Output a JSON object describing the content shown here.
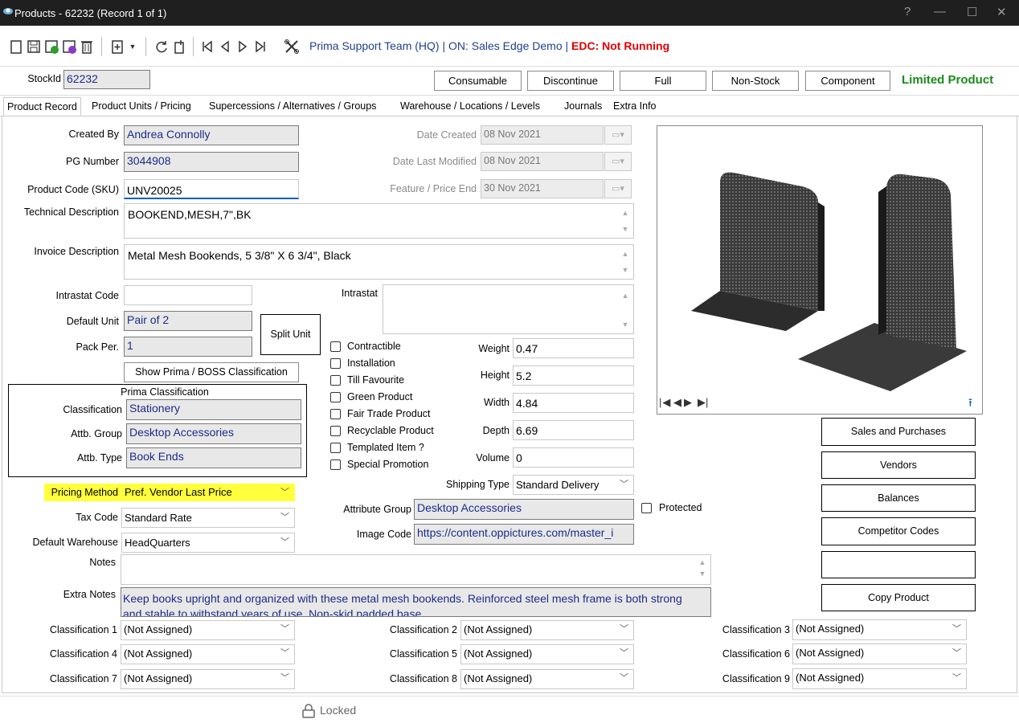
{
  "window": {
    "title": "Products - 62232  (Record 1 of 1)",
    "help": "?",
    "minimize": "—",
    "maximize": "☐",
    "close": "✕"
  },
  "toolbar": {
    "context_prefix": "Prima Support Team (HQ) | ON: Sales Edge Demo |",
    "edc_status": "EDC: Not Running"
  },
  "header": {
    "stockid_label": "StockId",
    "stockid_value": "62232",
    "buttons": [
      "Consumable",
      "Discontinue",
      "Full",
      "Non-Stock",
      "Component"
    ],
    "limited_label": "Limited Product"
  },
  "tabs": [
    "Product Record",
    "Product Units / Pricing",
    "Supercessions / Alternatives / Groups",
    "Warehouse / Locations / Levels",
    "Journals",
    "Extra Info"
  ],
  "form": {
    "created_by_label": "Created By",
    "created_by": "Andrea Connolly",
    "pg_number_label": "PG Number",
    "pg_number": "3044908",
    "sku_label": "Product Code (SKU)",
    "sku": "UNV20025",
    "tech_desc_label": "Technical Description",
    "tech_desc": "BOOKEND,MESH,7\",BK",
    "invoice_desc_label": "Invoice Description",
    "invoice_desc": "Metal Mesh Bookends, 5 3/8\" X 6 3/4\", Black",
    "date_created_label": "Date Created",
    "date_created": "08 Nov 2021",
    "date_modified_label": "Date Last Modified",
    "date_modified": "08 Nov 2021",
    "feature_end_label": "Feature / Price End",
    "feature_end": "30 Nov 2021",
    "intrastat_code_label": "Intrastat Code",
    "intrastat_code": "",
    "intrastat_label": "Intrastat",
    "default_unit_label": "Default Unit",
    "default_unit": "Pair of 2",
    "pack_per_label": "Pack Per.",
    "pack_per": "1",
    "split_unit": "Split Unit",
    "show_classification": "Show Prima / BOSS Classification",
    "prima_classification_title": "Prima Classification",
    "classification_label": "Classification",
    "classification": "Stationery",
    "attb_group_label": "Attb. Group",
    "attb_group": "Desktop Accessories",
    "attb_type_label": "Attb. Type",
    "attb_type": "Book Ends",
    "pricing_method_label": "Pricing Method",
    "pricing_method": "Pref. Vendor Last Price",
    "tax_code_label": "Tax Code",
    "tax_code": "Standard Rate",
    "default_warehouse_label": "Default Warehouse",
    "default_warehouse": "HeadQuarters",
    "notes_label": "Notes",
    "notes": "",
    "extra_notes_label": "Extra Notes",
    "extra_notes": "Keep books upright and organized with these metal mesh bookends. Reinforced steel mesh frame is both strong and stable to withstand years of use. Non-skid padded base"
  },
  "checkboxes": [
    "Contractible",
    "Installation",
    "Till Favourite",
    "Green Product",
    "Fair Trade Product",
    "Recyclable Product",
    "Templated Item ?",
    "Special Promotion"
  ],
  "dimensions": {
    "weight_label": "Weight",
    "weight": "0.47",
    "height_label": "Height",
    "height": "5.2",
    "width_label": "Width",
    "width": "4.84",
    "depth_label": "Depth",
    "depth": "6.69",
    "volume_label": "Volume",
    "volume": "0"
  },
  "shipping_type_label": "Shipping Type",
  "shipping_type": "Standard Delivery",
  "attribute_group_label": "Attribute Group",
  "attribute_group": "Desktop Accessories",
  "protected_label": "Protected",
  "image_code_label": "Image Code",
  "image_code": "https://content.oppictures.com/master_i",
  "side_buttons": [
    "Sales and Purchases",
    "Vendors",
    "Balances",
    "Competitor Codes",
    "",
    "Copy Product"
  ],
  "classifications": [
    {
      "label": "Classification 1",
      "value": "(Not Assigned)"
    },
    {
      "label": "Classification 2",
      "value": "(Not Assigned)"
    },
    {
      "label": "Classification 3",
      "value": "(Not Assigned)"
    },
    {
      "label": "Classification 4",
      "value": "(Not Assigned)"
    },
    {
      "label": "Classification 5",
      "value": "(Not Assigned)"
    },
    {
      "label": "Classification 6",
      "value": "(Not Assigned)"
    },
    {
      "label": "Classification 7",
      "value": "(Not Assigned)"
    },
    {
      "label": "Classification 8",
      "value": "(Not Assigned)"
    },
    {
      "label": "Classification 9",
      "value": "(Not Assigned)"
    }
  ],
  "image_nav": {
    "first": "|◀",
    "prev": "◀",
    "next": "▶",
    "last": "▶|",
    "upload": "⭱"
  },
  "status": {
    "locked": "Locked"
  },
  "colors": {
    "highlight": "#ffff3c",
    "accent_green": "#1a8a1a",
    "edc_red": "#e00000",
    "field_text": "#1c2c8c"
  }
}
